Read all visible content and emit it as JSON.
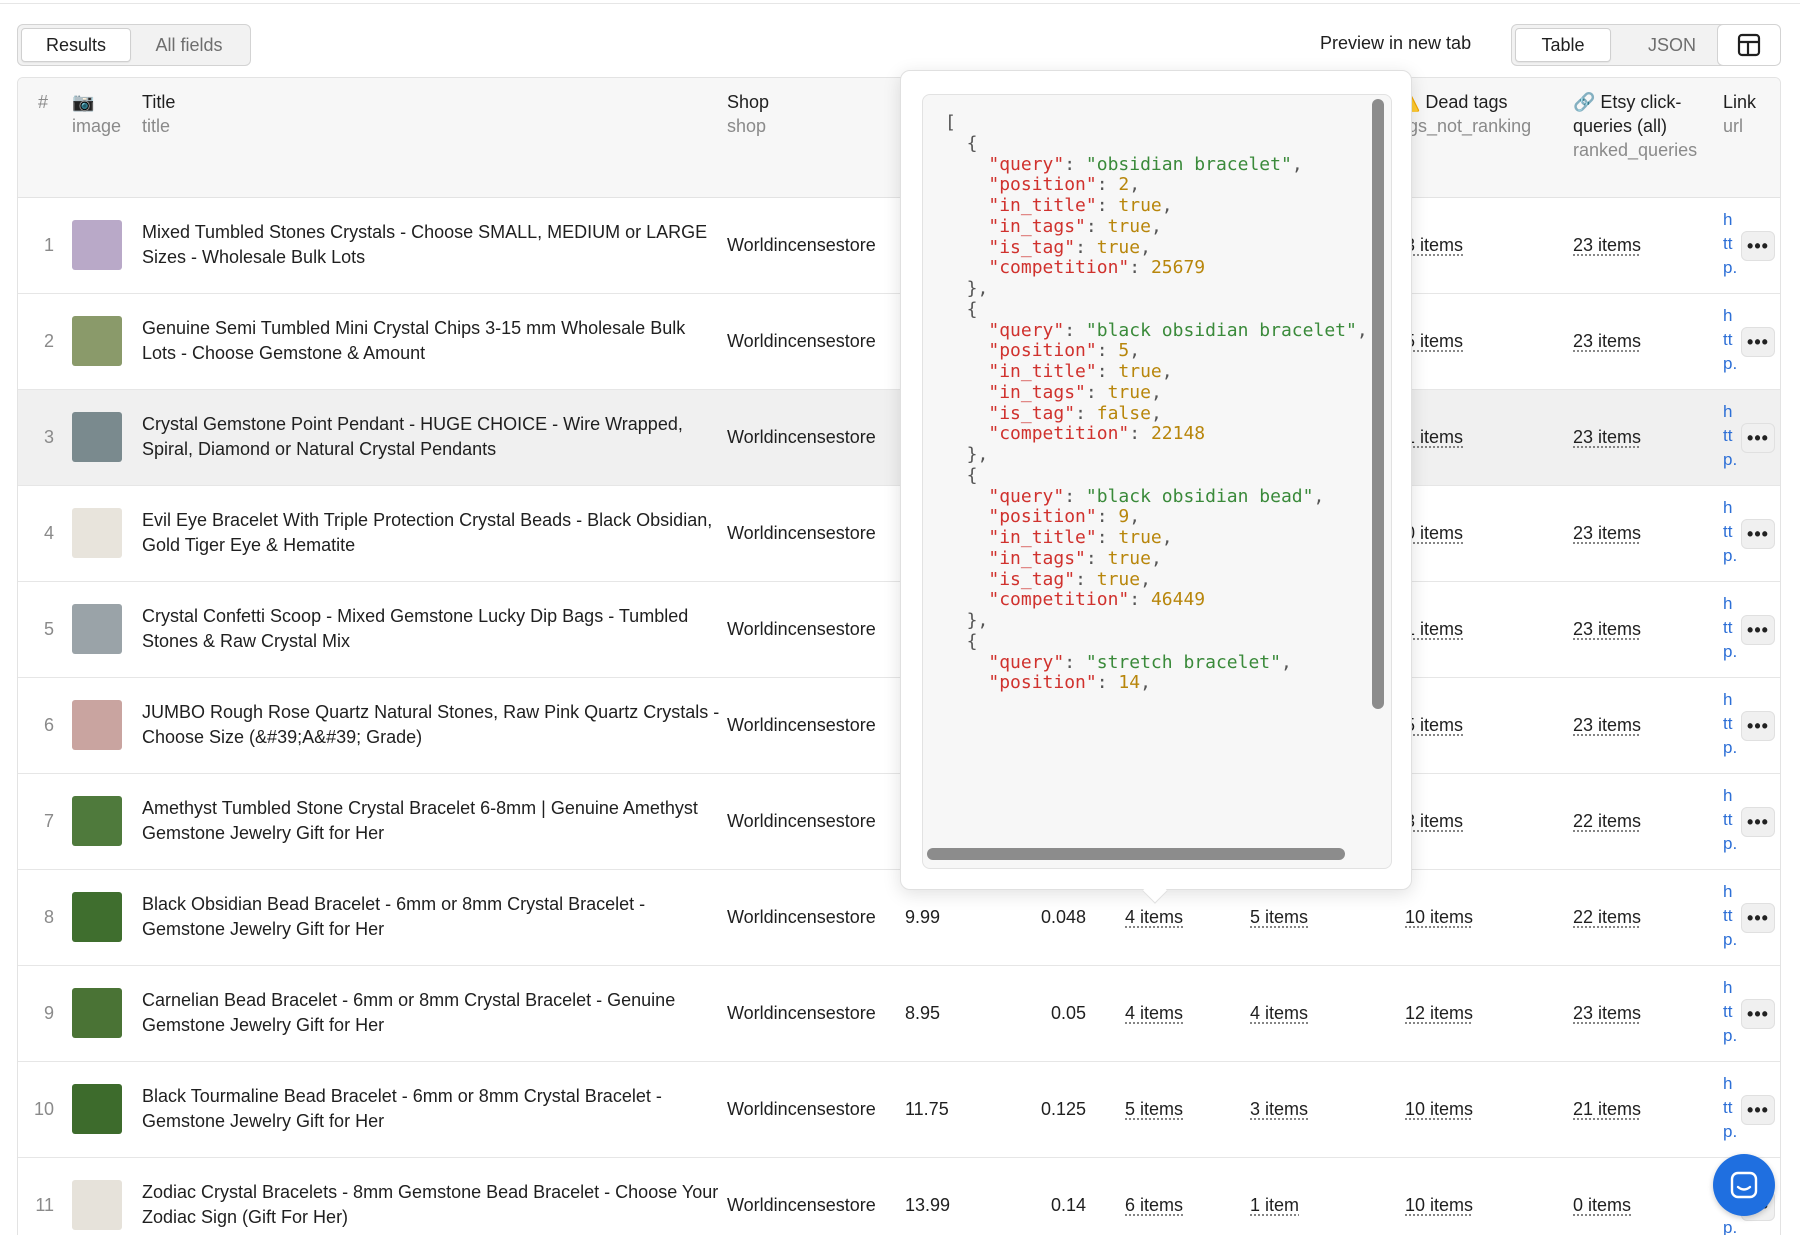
{
  "toolbar": {
    "view_tabs": [
      "Results",
      "All fields"
    ],
    "preview_label": "Preview in new tab",
    "format_tabs": [
      "Table",
      "JSON"
    ]
  },
  "columns": {
    "num": "#",
    "image": {
      "label": "image",
      "icon": "camera-icon"
    },
    "title": {
      "label": "Title",
      "field": "title"
    },
    "shop": {
      "label": "Shop",
      "field": "shop"
    },
    "dead_tags": {
      "label": "⚠️ Dead tags",
      "field": "ags_not_ranking"
    },
    "click_queries": {
      "label": "🔗 Etsy click-queries (all)",
      "field": "ranked_queries"
    },
    "link": {
      "label": "Link",
      "field": "url"
    }
  },
  "rows": [
    {
      "n": "1",
      "title": "Mixed Tumbled Stones Crystals - Choose SMALL, MEDIUM or LARGE Sizes - Wholesale Bulk Lots",
      "shop": "Worldincensestore",
      "price": "",
      "score": "",
      "c1": "",
      "c2": "",
      "dead": "3 items",
      "click": "23 items",
      "url": [
        "h",
        "tt",
        "p."
      ],
      "thumb": "#b9a9c8"
    },
    {
      "n": "2",
      "title": "Genuine Semi Tumbled Mini Crystal Chips 3-15 mm Wholesale Bulk Lots - Choose Gemstone & Amount",
      "shop": "Worldincensestore",
      "price": "",
      "score": "",
      "c1": "",
      "c2": "",
      "dead": "5 items",
      "click": "23 items",
      "url": [
        "h",
        "tt",
        "p."
      ],
      "thumb": "#8a9a6a"
    },
    {
      "n": "3",
      "title": "Crystal Gemstone Point Pendant - HUGE CHOICE - Wire Wrapped, Spiral, Diamond or Natural Crystal Pendants",
      "shop": "Worldincensestore",
      "price": "",
      "score": "",
      "c1": "",
      "c2": "",
      "dead": "1 items",
      "click": "23 items",
      "url": [
        "h",
        "tt",
        "p."
      ],
      "thumb": "#7a8a8e"
    },
    {
      "n": "4",
      "title": "Evil Eye Bracelet With Triple Protection Crystal Beads - Black Obsidian, Gold Tiger Eye & Hematite",
      "shop": "Worldincensestore",
      "price": "",
      "score": "",
      "c1": "",
      "c2": "",
      "dead": "0 items",
      "click": "23 items",
      "url": [
        "h",
        "tt",
        "p."
      ],
      "thumb": "#e8e4dc"
    },
    {
      "n": "5",
      "title": "Crystal Confetti Scoop - Mixed Gemstone Lucky Dip Bags - Tumbled Stones & Raw Crystal Mix",
      "shop": "Worldincensestore",
      "price": "",
      "score": "",
      "c1": "",
      "c2": "",
      "dead": "1 items",
      "click": "23 items",
      "url": [
        "h",
        "tt",
        "p."
      ],
      "thumb": "#9aa3a8"
    },
    {
      "n": "6",
      "title": "JUMBO Rough Rose Quartz Natural Stones, Raw Pink Quartz Crystals - Choose Size (&#39;A&#39; Grade)",
      "shop": "Worldincensestore",
      "price": "",
      "score": "",
      "c1": "",
      "c2": "",
      "dead": "5 items",
      "click": "23 items",
      "url": [
        "h",
        "tt",
        "p."
      ],
      "thumb": "#c9a4a0"
    },
    {
      "n": "7",
      "title": "Amethyst Tumbled Stone Crystal Bracelet 6-8mm | Genuine Amethyst Gemstone Jewelry Gift for Her",
      "shop": "Worldincensestore",
      "price": "",
      "score": "",
      "c1": "",
      "c2": "",
      "dead": "3 items",
      "click": "22 items",
      "url": [
        "h",
        "tt",
        "p."
      ],
      "thumb": "#4f7a3c"
    },
    {
      "n": "8",
      "title": "Black Obsidian Bead Bracelet - 6mm or 8mm Crystal Bracelet - Gemstone Jewelry Gift for Her",
      "shop": "Worldincensestore",
      "price": "9.99",
      "score": "0.048",
      "c1": "4 items",
      "c2": "5 items",
      "dead": "10 items",
      "click": "22 items",
      "url": [
        "h",
        "tt",
        "p."
      ],
      "thumb": "#3f6e2e"
    },
    {
      "n": "9",
      "title": "Carnelian Bead Bracelet - 6mm or 8mm Crystal Bracelet - Genuine Gemstone Jewelry Gift for Her",
      "shop": "Worldincensestore",
      "price": "8.95",
      "score": "0.05",
      "c1": "4 items",
      "c2": "4 items",
      "dead": "12 items",
      "click": "23 items",
      "url": [
        "h",
        "tt",
        "p."
      ],
      "thumb": "#4a7335"
    },
    {
      "n": "10",
      "title": "Black Tourmaline Bead Bracelet - 6mm or 8mm Crystal Bracelet - Gemstone Jewelry Gift for Her",
      "shop": "Worldincensestore",
      "price": "11.75",
      "score": "0.125",
      "c1": "5 items",
      "c2": "3 items",
      "dead": "10 items",
      "click": "21 items",
      "url": [
        "h",
        "tt",
        "p."
      ],
      "thumb": "#3d6b2c"
    },
    {
      "n": "11",
      "title": "Zodiac Crystal Bracelets - 8mm Gemstone Bead Bracelet - Choose Your Zodiac Sign (Gift For Her)",
      "shop": "Worldincensestore",
      "price": "13.99",
      "score": "0.14",
      "c1": "6 items",
      "c2": "1 item",
      "dead": "10 items",
      "click": "0 items",
      "url": [
        "h",
        "tt",
        "p."
      ],
      "thumb": "#e6e2da"
    }
  ],
  "json_popover": {
    "entries": [
      {
        "query": "obsidian bracelet",
        "position": "2",
        "in_title": "true",
        "in_tags": "true",
        "is_tag": "true",
        "competition": "25679"
      },
      {
        "query": "black obsidian bracelet",
        "position": "5",
        "in_title": "true",
        "in_tags": "true",
        "is_tag": "false",
        "competition": "22148"
      },
      {
        "query": "black obsidian bead",
        "position": "9",
        "in_title": "true",
        "in_tags": "true",
        "is_tag": "true",
        "competition": "46449"
      },
      {
        "query": "stretch bracelet",
        "position": "14"
      }
    ]
  },
  "colors": {
    "accent": "#1f6fe0",
    "json_key": "#d0312d",
    "json_string": "#3a8a3a",
    "json_number": "#b8860b",
    "link": "#2d6fd6"
  }
}
